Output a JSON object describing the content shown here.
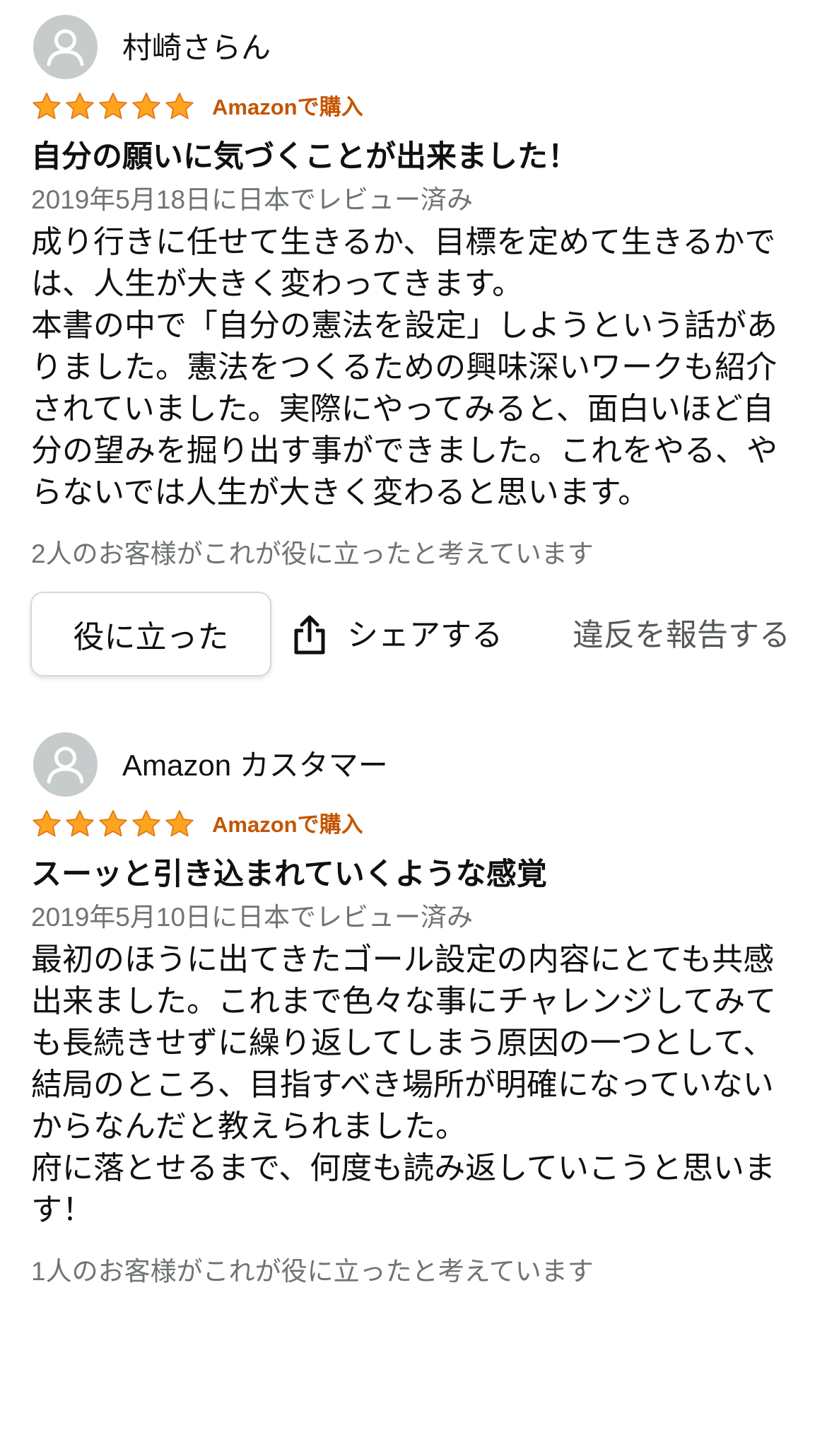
{
  "reviews": [
    {
      "reviewer": "村崎さらん",
      "rating": 5,
      "badge": "Amazonで購入",
      "title": "自分の願いに気づくことが出来ました！",
      "date": "2019年5月18日に日本でレビュー済み",
      "body": [
        "成り行きに任せて生きるか、目標を定めて生きるかで",
        "は、人生が大きく変わってきます。",
        "本書の中で「自分の憲法を設定」しようという話があ",
        "りました。憲法をつくるための興味深いワークも紹介",
        "されていました。実際にやってみると、面白いほど自",
        "分の望みを掘り出す事ができました。これをやる、や",
        "らないでは人生が大きく変わると思います。"
      ],
      "helpful_count_text": "2人のお客様がこれが役に立ったと考えています",
      "actions": {
        "helpful": "役に立った",
        "share": "シェアする",
        "report": "違反を報告する"
      }
    },
    {
      "reviewer": "Amazon カスタマー",
      "rating": 5,
      "badge": "Amazonで購入",
      "title": "スーッと引き込まれていくような感覚",
      "date": "2019年5月10日に日本でレビュー済み",
      "body": [
        "最初のほうに出てきたゴール設定の内容にとても共感",
        "出来ました。これまで色々な事にチャレンジしてみて",
        "も長続きせずに繰り返してしまう原因の一つとして、",
        "結局のところ、目指すべき場所が明確になっていない",
        "からなんだと教えられました。",
        "府に落とせるまで、何度も読み返していこうと思いま",
        "す！"
      ],
      "helpful_count_text": "1人のお客様がこれが役に立ったと考えています"
    }
  ],
  "icons": {
    "avatar": "person-icon",
    "rating": "star-icon",
    "share": "share-icon"
  },
  "colors": {
    "text": "#0f1111",
    "secondary_text": "#6f7373",
    "badge": "#c45500",
    "star_fill": "#ffa41c",
    "star_stroke": "#de7921",
    "avatar_bg": "#c6cbcb"
  }
}
